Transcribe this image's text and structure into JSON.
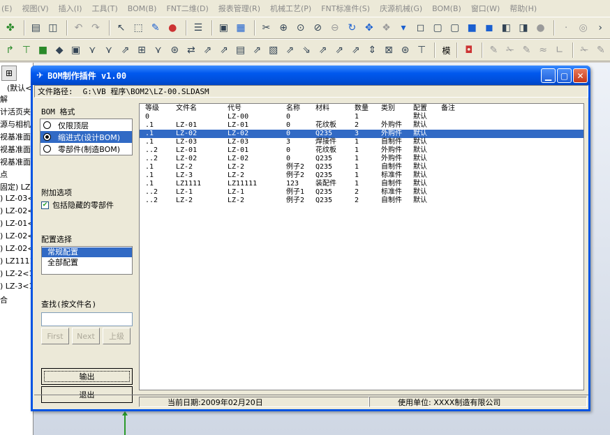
{
  "menu": [
    "(E)",
    "视图(V)",
    "插入(I)",
    "工具(T)",
    "BOM(B)",
    "FNT二维(D)",
    "报表管理(R)",
    "机械工艺(P)",
    "FNT标准件(S)",
    "庆源机械(G)",
    "BOM(B)",
    "窗口(W)",
    "帮助(H)"
  ],
  "toolbar": {
    "text_mo": "模"
  },
  "tree": {
    "default_label": "(默认<",
    "items": [
      "解",
      "计活页夹",
      "源与相机",
      "视基准面",
      "视基准面",
      "视基准面",
      "点",
      "固定) LZ-",
      ") LZ-03<",
      ") LZ-02<",
      ") LZ-01<",
      ") LZ-02<",
      ") LZ-02<",
      ") LZ1111",
      ") LZ-2<1",
      ") LZ-3<1",
      "合"
    ]
  },
  "dialog": {
    "title": "BOM制作插件 v1.00",
    "file_path_label": "文件路径:",
    "file_path": "G:\\VB 程序\\BOM2\\LZ-00.SLDASM",
    "bom_format_label": "BOM 格式",
    "bom_formats": [
      {
        "label": "仅限顶层",
        "checked": false,
        "selected": false
      },
      {
        "label": "缩进式(设计BOM)",
        "checked": true,
        "selected": true
      },
      {
        "label": "零部件(制造BOM)",
        "checked": false,
        "selected": false
      }
    ],
    "extra_options_label": "附加选项",
    "include_hidden_label": "包括隐藏的零部件",
    "include_hidden_checked": true,
    "config_label": "配置选择",
    "configs": [
      {
        "label": "常规配置",
        "selected": true
      },
      {
        "label": "全部配置",
        "selected": false
      }
    ],
    "find_label": "查找(按文件名)",
    "find_value": "",
    "btn_first": "First",
    "btn_next": "Next",
    "btn_up": "上级",
    "btn_export": "输出",
    "btn_exit": "退出",
    "table": {
      "headers": [
        "等级",
        "文件名",
        "代号",
        "名称",
        "材料",
        "数量",
        "类别",
        "配置",
        "备注"
      ],
      "rows": [
        [
          "0",
          "",
          "LZ-00",
          "0",
          "",
          "1",
          "",
          "默认",
          ""
        ],
        [
          ".1",
          "LZ-01",
          "LZ-01",
          "0",
          "花纹板",
          "2",
          "外购件",
          "默认",
          ""
        ],
        [
          ".1",
          "LZ-02",
          "LZ-02",
          "0",
          "Q235",
          "3",
          "外购件",
          "默认",
          ""
        ],
        [
          ".1",
          "LZ-03",
          "LZ-03",
          "3",
          "焊接件",
          "1",
          "自制件",
          "默认",
          ""
        ],
        [
          "..2",
          "LZ-01",
          "LZ-01",
          "0",
          "花纹板",
          "1",
          "外购件",
          "默认",
          ""
        ],
        [
          "..2",
          "LZ-02",
          "LZ-02",
          "0",
          "Q235",
          "1",
          "外购件",
          "默认",
          ""
        ],
        [
          ".1",
          "LZ-2",
          "LZ-2",
          "例子2",
          "Q235",
          "1",
          "自制件",
          "默认",
          ""
        ],
        [
          ".1",
          "LZ-3",
          "LZ-2",
          "例子2",
          "Q235",
          "1",
          "标准件",
          "默认",
          ""
        ],
        [
          ".1",
          "LZ1111",
          "LZ11111",
          "123",
          "装配件",
          "1",
          "自制件",
          "默认",
          ""
        ],
        [
          "..2",
          "LZ-1",
          "LZ-1",
          "例子1",
          "Q235",
          "2",
          "标准件",
          "默认",
          ""
        ],
        [
          "..2",
          "LZ-2",
          "LZ-2",
          "例子2",
          "Q235",
          "2",
          "自制件",
          "默认",
          ""
        ]
      ],
      "selected_row": 2
    },
    "status_date": "当前日期:2009年02月20日",
    "status_company": "使用单位: XXXX制造有限公司"
  }
}
